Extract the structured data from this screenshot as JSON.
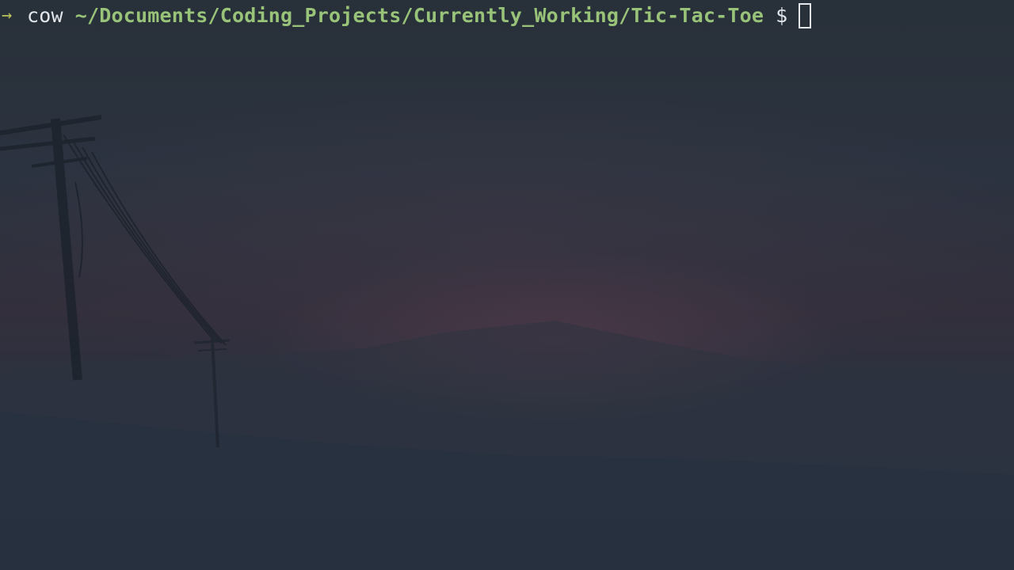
{
  "terminal": {
    "prompt": {
      "arrow_icon": "arrow-right-icon",
      "arrow_glyph": "→",
      "user": "cow",
      "path": "~/Documents/Coding_Projects/Currently_Working/Tic-Tac-Toe",
      "symbol": "$"
    },
    "colors": {
      "background": "#2a313c",
      "arrow": "#b8c25a",
      "user": "#e3e6ea",
      "path": "#98c379",
      "cursor": "#e3e6ea"
    }
  }
}
